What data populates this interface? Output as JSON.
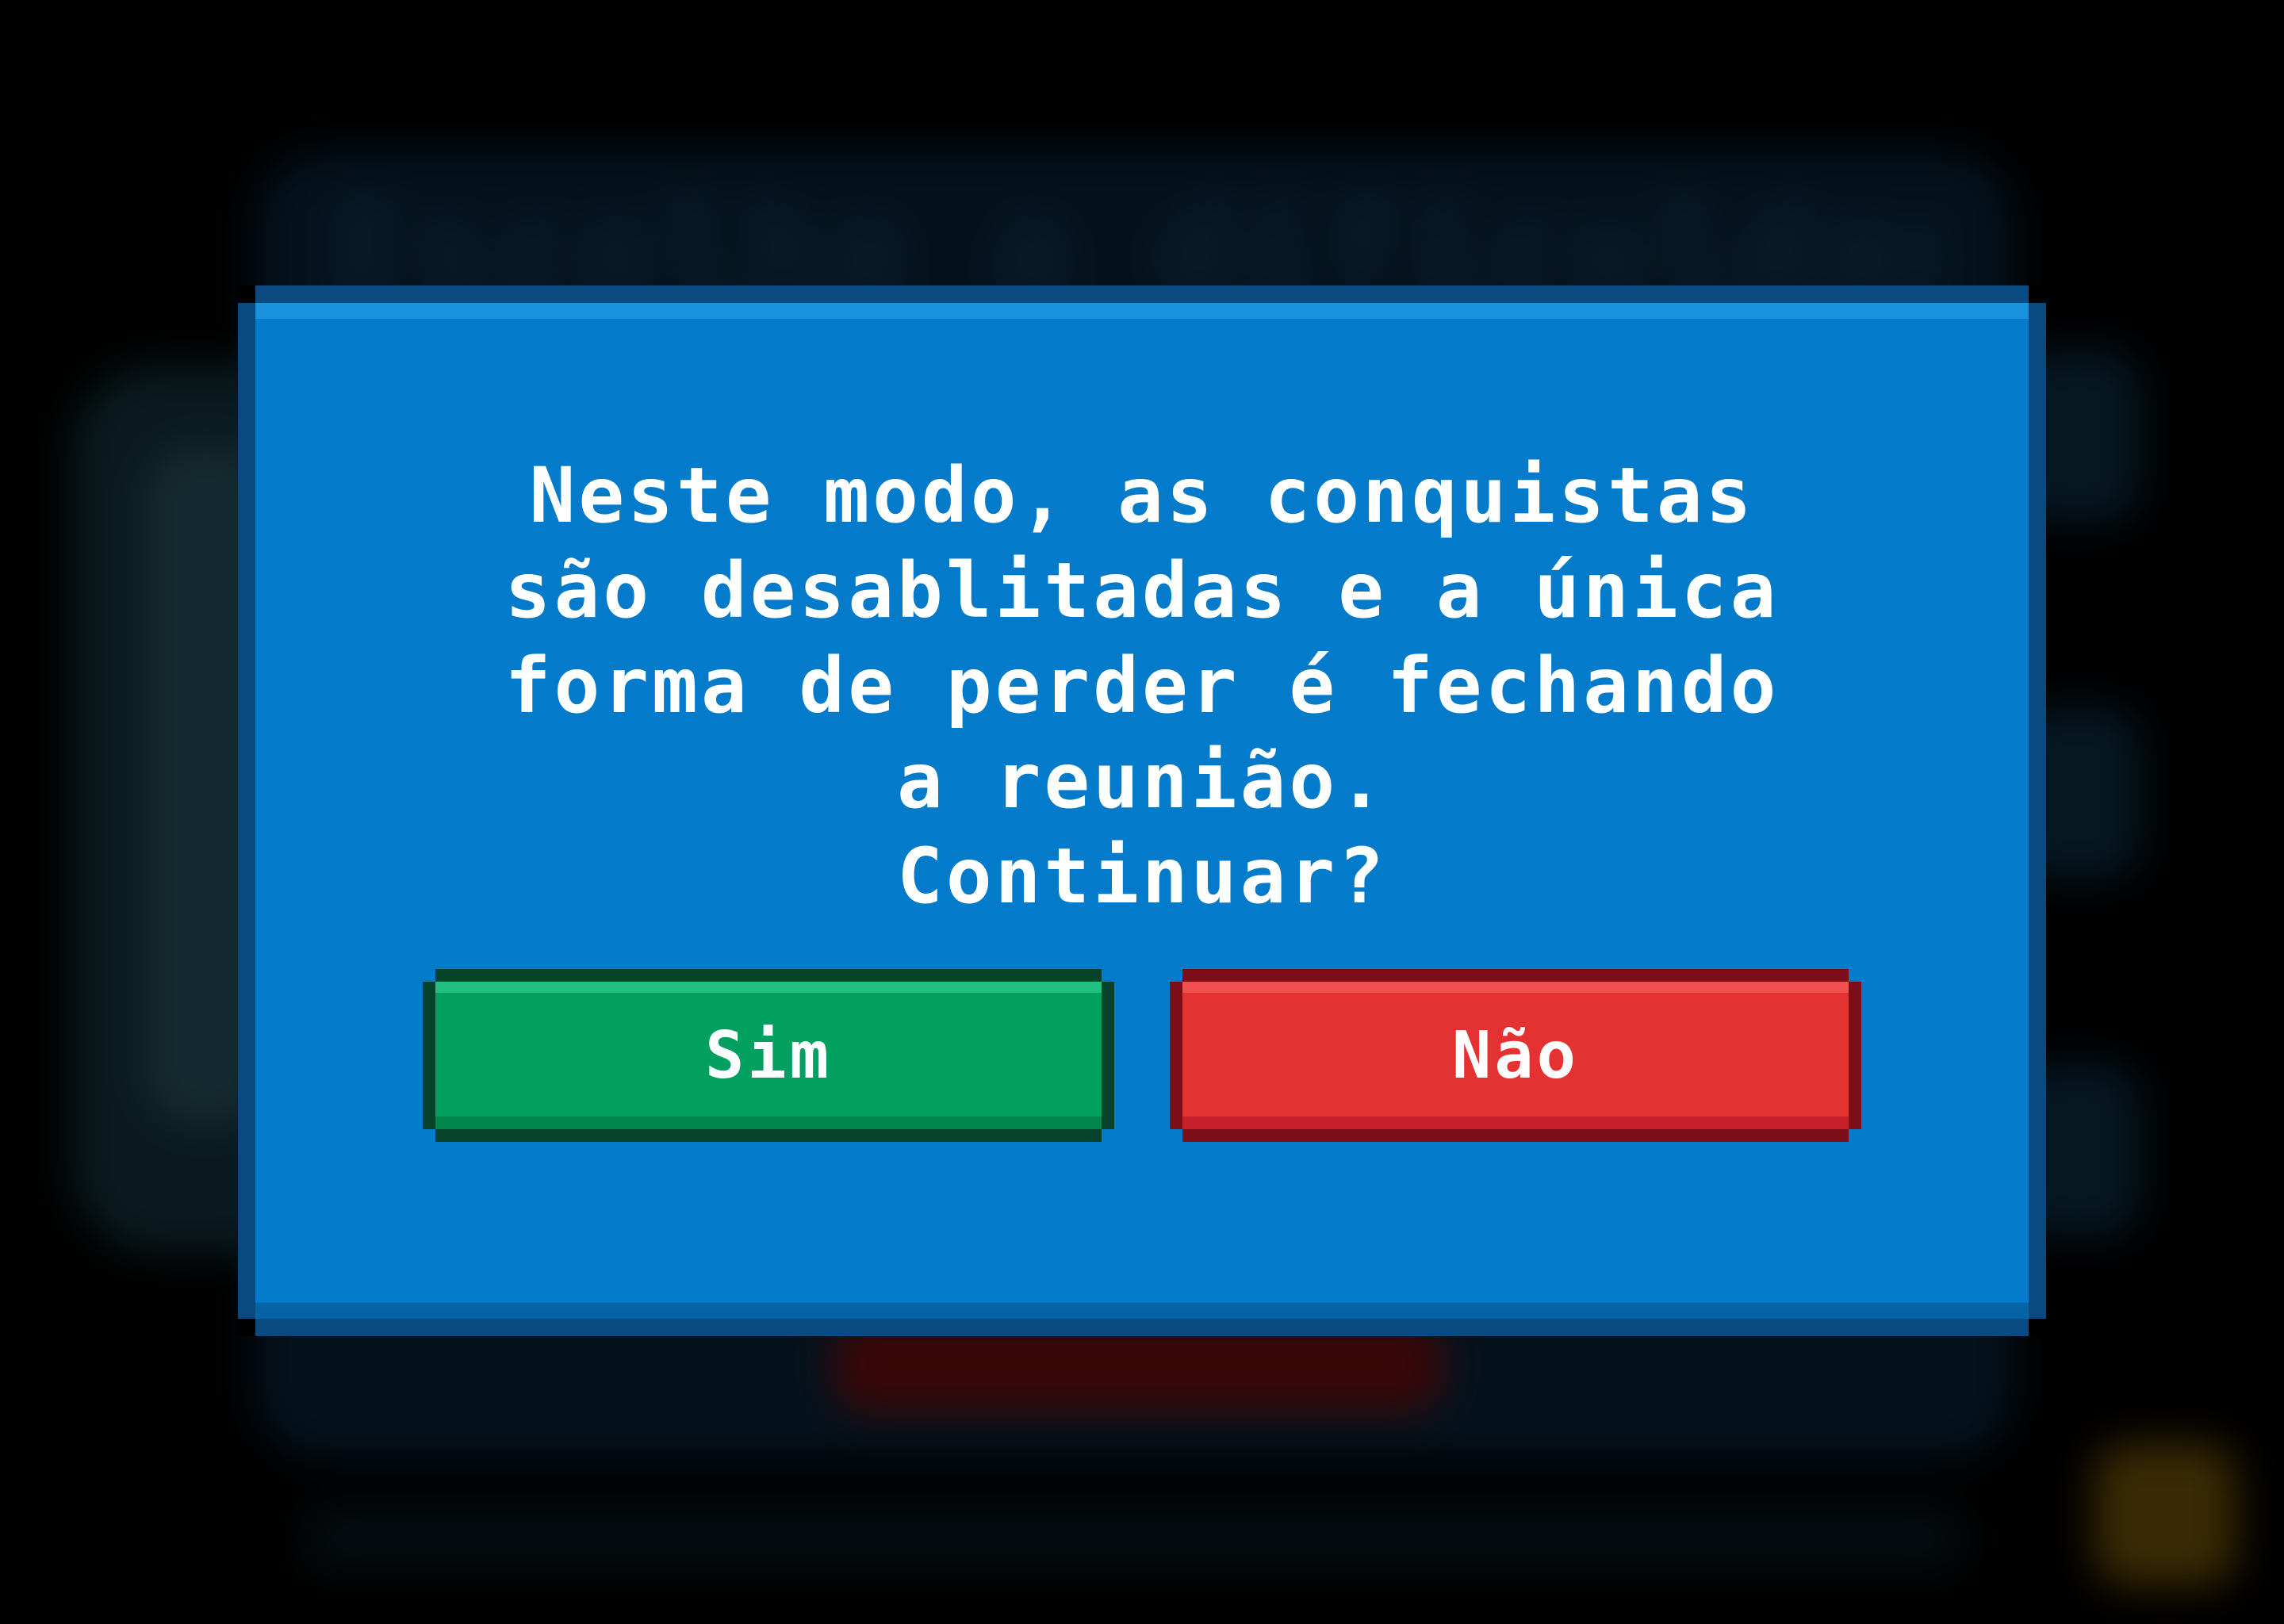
{
  "background": {
    "title_text": "Escolha a dificuldade"
  },
  "dialog": {
    "message": "Neste modo, as conquistas\nsão desablitadas e a única\nforma de perder é fechando\na reunião.\nContinuar?",
    "confirm_label": "Sim",
    "cancel_label": "Não"
  },
  "colors": {
    "dialog_blue": "#037bca",
    "confirm_green": "#01a060",
    "cancel_red": "#e43232"
  }
}
